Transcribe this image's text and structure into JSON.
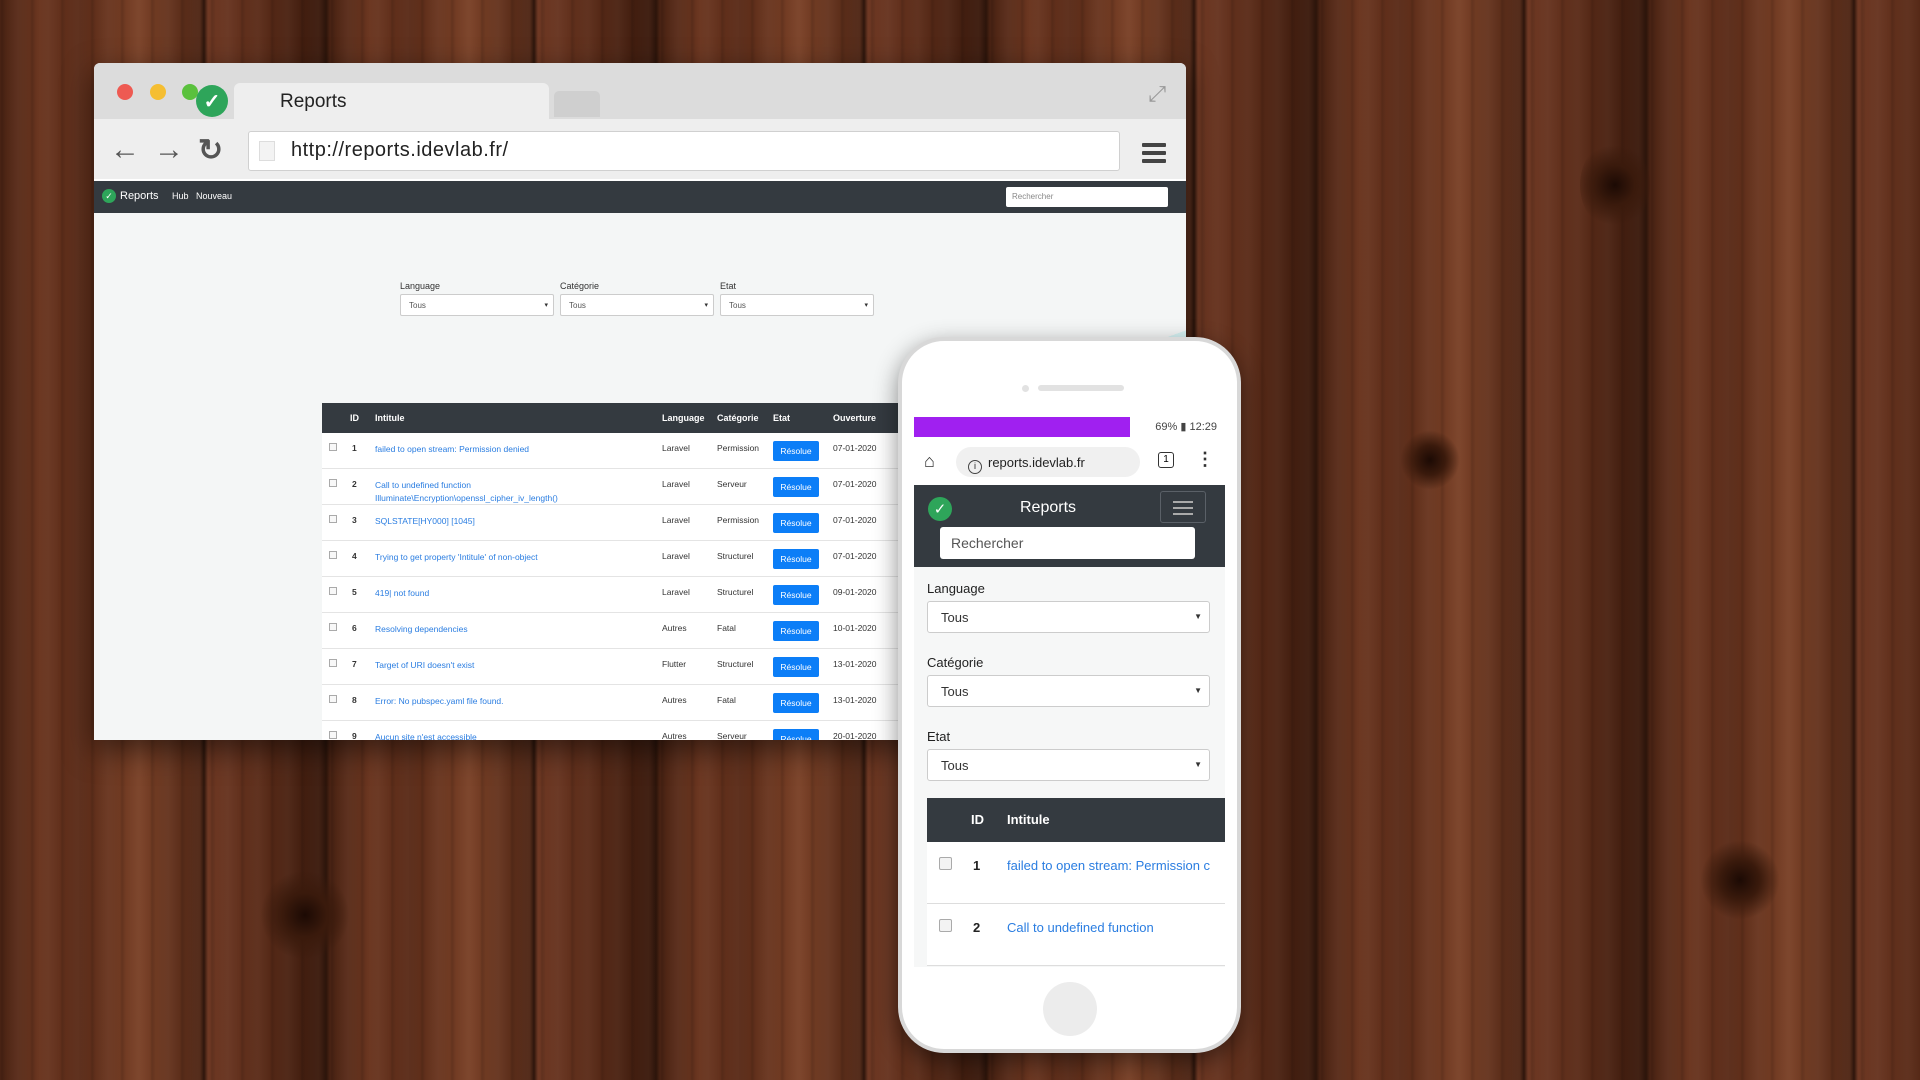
{
  "browser": {
    "tab_title": "Reports",
    "url": "http://reports.idevlab.fr/"
  },
  "app": {
    "brand": "Reports",
    "nav_links": [
      "Hub",
      "Nouveau"
    ],
    "search_placeholder": "Rechercher",
    "filters": [
      {
        "label": "Language",
        "value": "Tous"
      },
      {
        "label": "Catégorie",
        "value": "Tous"
      },
      {
        "label": "Etat",
        "value": "Tous"
      }
    ],
    "table": {
      "headers": [
        "ID",
        "Intitule",
        "Language",
        "Catégorie",
        "Etat",
        "Ouverture"
      ],
      "rows": [
        {
          "id": "1",
          "title": "failed to open stream: Permission denied",
          "lang": "Laravel",
          "cat": "Permission",
          "etat": "Résolue",
          "date": "07-01-2020"
        },
        {
          "id": "2",
          "title": "Call to undefined function Illuminate\\Encryption\\openssl_cipher_iv_length()",
          "lang": "Laravel",
          "cat": "Serveur",
          "etat": "Résolue",
          "date": "07-01-2020"
        },
        {
          "id": "3",
          "title": "SQLSTATE[HY000] [1045]",
          "lang": "Laravel",
          "cat": "Permission",
          "etat": "Résolue",
          "date": "07-01-2020"
        },
        {
          "id": "4",
          "title": "Trying to get property 'Intitule' of non-object",
          "lang": "Laravel",
          "cat": "Structurel",
          "etat": "Résolue",
          "date": "07-01-2020"
        },
        {
          "id": "5",
          "title": "419| not found",
          "lang": "Laravel",
          "cat": "Structurel",
          "etat": "Résolue",
          "date": "09-01-2020"
        },
        {
          "id": "6",
          "title": "Resolving dependencies",
          "lang": "Autres",
          "cat": "Fatal",
          "etat": "Résolue",
          "date": "10-01-2020"
        },
        {
          "id": "7",
          "title": "Target of URI doesn't exist",
          "lang": "Flutter",
          "cat": "Structurel",
          "etat": "Résolue",
          "date": "13-01-2020"
        },
        {
          "id": "8",
          "title": "Error: No pubspec.yaml file found.",
          "lang": "Autres",
          "cat": "Fatal",
          "etat": "Résolue",
          "date": "13-01-2020"
        },
        {
          "id": "9",
          "title": "Aucun site n'est accessible",
          "lang": "Autres",
          "cat": "Serveur",
          "etat": "Résolue",
          "date": "20-01-2020"
        }
      ]
    }
  },
  "phone": {
    "status_right": "69% ▮ 12:29",
    "url": "reports.idevlab.fr",
    "tabs_count": "1",
    "brand": "Reports",
    "search_placeholder": "Rechercher",
    "filters": [
      {
        "label": "Language",
        "value": "Tous"
      },
      {
        "label": "Catégorie",
        "value": "Tous"
      },
      {
        "label": "Etat",
        "value": "Tous"
      }
    ],
    "table_headers": [
      "ID",
      "Intitule"
    ],
    "rows": [
      {
        "id": "1",
        "title": "failed to open stream: Permission c"
      },
      {
        "id": "2",
        "title": "Call to undefined function"
      }
    ]
  },
  "colors": {
    "navbar": "#343a40",
    "accent_blue": "#0c7ef7",
    "link_blue": "#2a7de1",
    "logo_green": "#2ea55a",
    "status_purple": "#a020f0"
  }
}
